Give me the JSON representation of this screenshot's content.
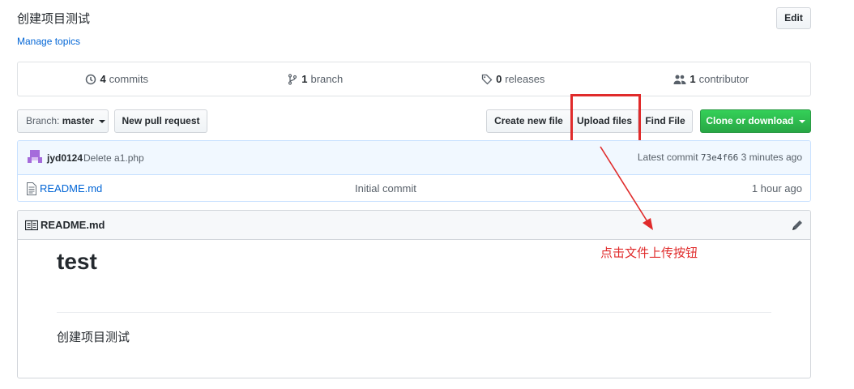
{
  "repo": {
    "description": "创建项目测试",
    "manage_topics": "Manage topics",
    "edit_label": "Edit"
  },
  "numbers": {
    "commits_count": "4",
    "commits_label": "commits",
    "branch_count": "1",
    "branch_label": "branch",
    "releases_count": "0",
    "releases_label": "releases",
    "contributor_count": "1",
    "contributor_label": "contributor"
  },
  "toolbar": {
    "branch_prefix": "Branch:",
    "branch_name": "master",
    "new_pr": "New pull request",
    "create_file": "Create new file",
    "upload_files": "Upload files",
    "find_file": "Find File",
    "clone": "Clone or download"
  },
  "commit": {
    "author": "jyd0124",
    "message": "Delete a1.php",
    "latest_label": "Latest commit",
    "sha": "73e4f66",
    "age": "3 minutes ago"
  },
  "files": [
    {
      "name": "README.md",
      "message": "Initial commit",
      "age": "1 hour ago"
    }
  ],
  "readme": {
    "title": "README.md",
    "heading": "test",
    "body": "创建项目测试"
  },
  "annotation": {
    "text": "点击文件上传按钮",
    "color": "#e02b2b"
  },
  "colors": {
    "link": "#0366d6",
    "clone_green": "#28a745"
  }
}
